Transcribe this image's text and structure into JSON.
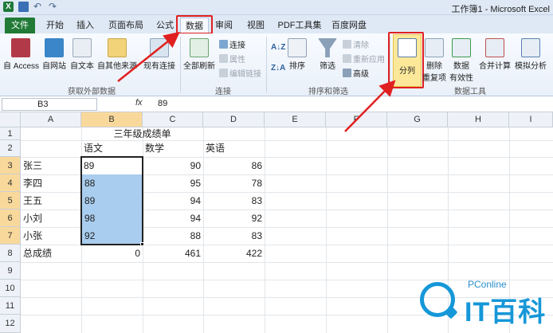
{
  "window": {
    "title": "工作簿1 - Microsoft Excel"
  },
  "tabs": {
    "file": "文件",
    "items": [
      "开始",
      "插入",
      "页面布局",
      "公式",
      "数据",
      "审阅",
      "视图",
      "PDF工具集",
      "百度网盘"
    ],
    "active": "数据"
  },
  "ribbon": {
    "get_external": {
      "label": "获取外部数据",
      "buttons": [
        "自 Access",
        "自网站",
        "自文本",
        "自其他来源",
        "现有连接"
      ]
    },
    "connections": {
      "label": "连接",
      "refresh_all": "全部刷新",
      "items": [
        "连接",
        "属性",
        "编辑链接"
      ]
    },
    "sort_filter": {
      "label": "排序和筛选",
      "sort": "排序",
      "filter": "筛选",
      "items": [
        "清除",
        "重新应用",
        "高级"
      ]
    },
    "data_tools": {
      "label": "数据工具",
      "text_to_columns": "分列",
      "remove_duplicates": [
        "删除",
        "重复项"
      ],
      "validation": [
        "数据",
        "有效性"
      ],
      "consolidate": "合并计算",
      "what_if": "模拟分析"
    }
  },
  "formula_bar": {
    "name_box": "B3",
    "fx": "fx",
    "value": "89"
  },
  "sheet": {
    "columns": [
      "A",
      "B",
      "C",
      "D",
      "E",
      "F",
      "G",
      "H",
      "I"
    ],
    "rows": [
      "1",
      "2",
      "3",
      "4",
      "5",
      "6",
      "7",
      "8",
      "9",
      "10",
      "11",
      "12"
    ],
    "title": "三年级成绩单",
    "headers": [
      "语文",
      "数学",
      "英语"
    ],
    "students": [
      {
        "name": "张三",
        "chinese": "89",
        "math": "90",
        "english": "86"
      },
      {
        "name": "李四",
        "chinese": "88",
        "math": "95",
        "english": "78"
      },
      {
        "name": "王五",
        "chinese": "89",
        "math": "94",
        "english": "83"
      },
      {
        "name": "小刘",
        "chinese": "98",
        "math": "94",
        "english": "92"
      },
      {
        "name": "小张",
        "chinese": "92",
        "math": "88",
        "english": "83"
      }
    ],
    "total": {
      "label": "总成绩",
      "chinese": "0",
      "math": "461",
      "english": "422"
    }
  },
  "watermark": {
    "small": "PConline",
    "big": "IT百科"
  },
  "colors": {
    "annotation": "#e02020",
    "accent": "#1597d8",
    "file_tab": "#217a36",
    "selection": "#a9cdef"
  }
}
